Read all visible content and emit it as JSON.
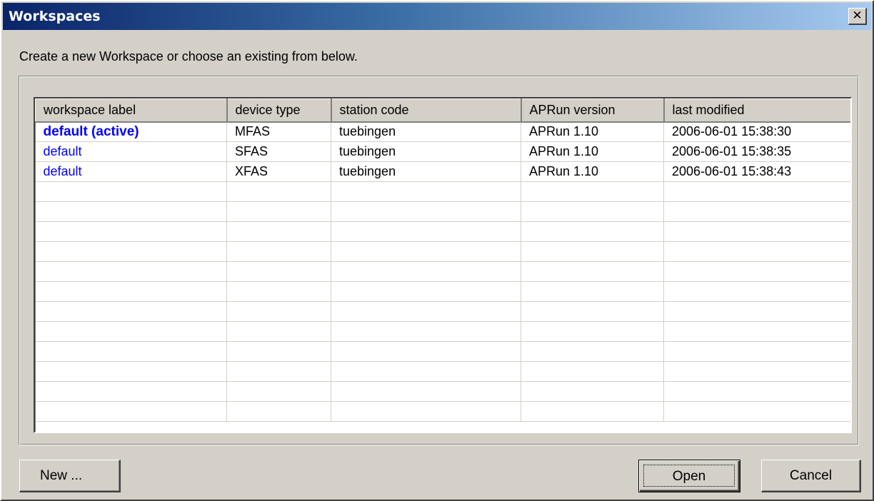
{
  "window": {
    "title": "Workspaces",
    "close_glyph": "✕"
  },
  "prompt": "Create a new Workspace or choose an existing from below.",
  "table": {
    "columns": [
      "workspace label",
      "device type",
      "station code",
      "APRun version",
      "last modified"
    ],
    "rows": [
      [
        "default (active)",
        "MFAS",
        "tuebingen",
        "APRun 1.10",
        "2006-06-01 15:38:30"
      ],
      [
        "default",
        "SFAS",
        "tuebingen",
        "APRun 1.10",
        "2006-06-01 15:38:35"
      ],
      [
        "default",
        "XFAS",
        "tuebingen",
        "APRun 1.10",
        "2006-06-01 15:38:43"
      ]
    ],
    "active_row": 0,
    "label_color": "#0000ff"
  },
  "buttons": {
    "new": "New ...",
    "open": "Open",
    "cancel": "Cancel"
  },
  "colors": {
    "title_gradient_start": "#0a246a",
    "title_gradient_end": "#a6caf0",
    "dialog_bg": "#d4d0c8"
  }
}
